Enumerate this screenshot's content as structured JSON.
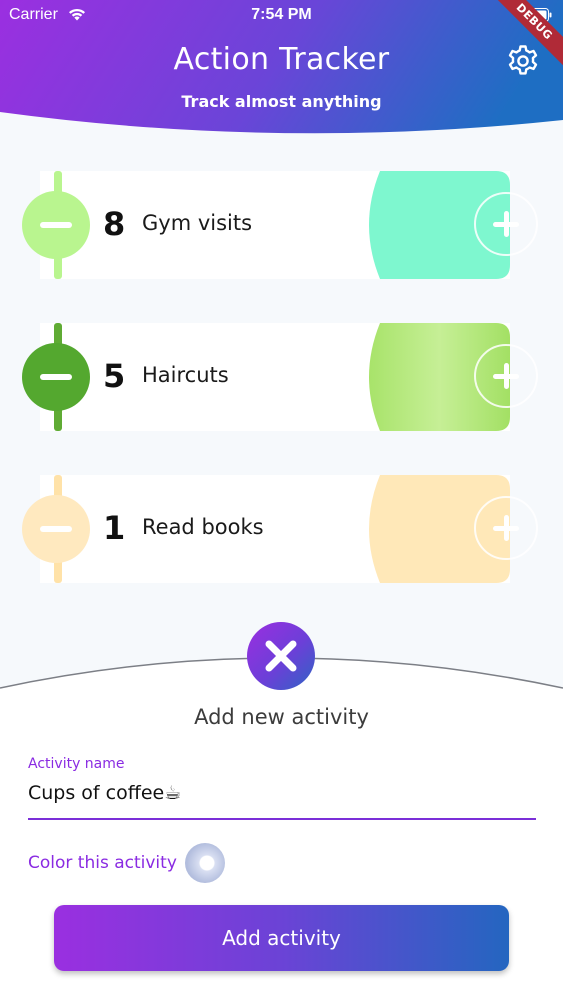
{
  "status_bar": {
    "carrier": "Carrier",
    "time": "7:54 PM"
  },
  "header": {
    "title": "Action Tracker",
    "subtitle": "Track almost anything",
    "debug_badge": "DEBUG"
  },
  "activities": [
    {
      "count": "8",
      "name": "Gym visits",
      "color": "#7ef7cf",
      "minus_color": "#b9f58f",
      "stripe_color": "#b9f58f"
    },
    {
      "count": "5",
      "name": "Haircuts",
      "color": "#a8e36a",
      "minus_color": "#54a82f",
      "stripe_color": "#5fab34"
    },
    {
      "count": "1",
      "name": "Read books",
      "color": "#ffe8b8",
      "minus_color": "#ffe9bf",
      "stripe_color": "#ffe2a8"
    }
  ],
  "new_activity": {
    "title": "Add new activity",
    "field_label": "Activity name",
    "field_value": "Cups of coffee☕",
    "color_label": "Color this activity",
    "submit_label": "Add activity"
  },
  "icons": {
    "wifi": "wifi-icon",
    "battery": "battery-icon",
    "settings": "gear-icon",
    "minus": "minus-icon",
    "plus": "plus-icon",
    "close": "close-icon"
  },
  "colors": {
    "accent": "#8a2be2",
    "gradient_start": "#9a2fe0",
    "gradient_end": "#2466c0"
  }
}
